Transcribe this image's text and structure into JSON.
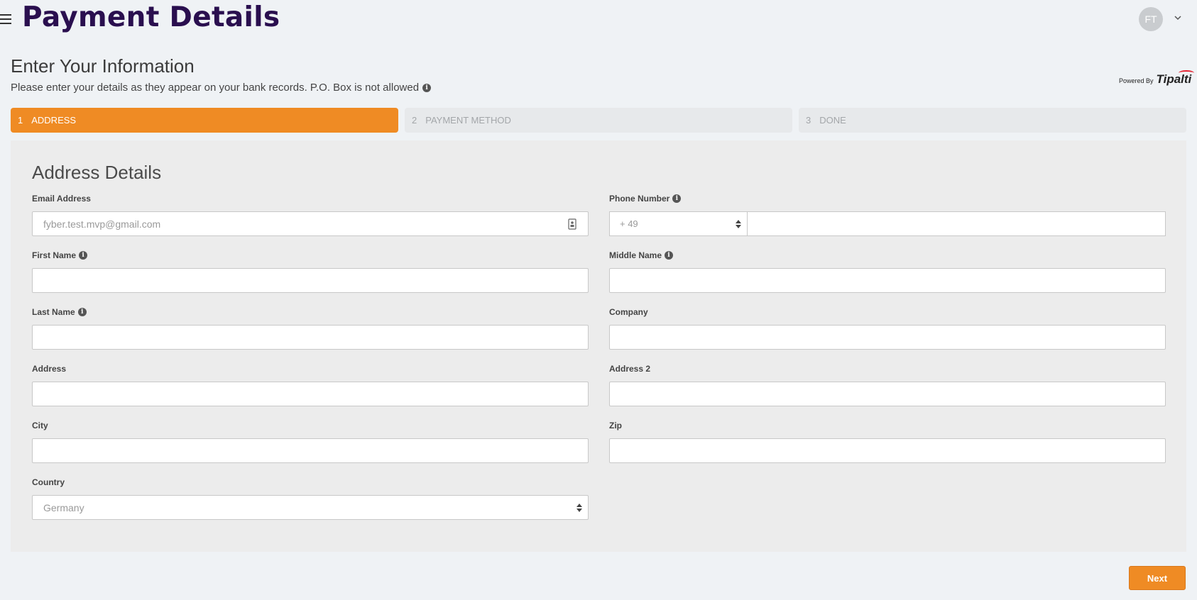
{
  "header": {
    "title": "Payment Details",
    "avatar_initials": "FT"
  },
  "intro": {
    "title": "Enter Your Information",
    "subtitle": "Please enter your details as they appear on your bank records. P.O. Box is not allowed"
  },
  "powered_by": {
    "label": "Powered By",
    "brand": "Tipalti"
  },
  "steps": [
    {
      "num": "1",
      "label": "ADDRESS",
      "active": true
    },
    {
      "num": "2",
      "label": "PAYMENT METHOD",
      "active": false
    },
    {
      "num": "3",
      "label": "DONE",
      "active": false
    }
  ],
  "form": {
    "title": "Address Details",
    "email": {
      "label": "Email Address",
      "value": "fyber.test.mvp@gmail.com"
    },
    "phone": {
      "label": "Phone Number",
      "code": "+ 49",
      "value": ""
    },
    "first_name": {
      "label": "First Name",
      "value": ""
    },
    "middle_name": {
      "label": "Middle Name",
      "value": ""
    },
    "last_name": {
      "label": "Last Name",
      "value": ""
    },
    "company": {
      "label": "Company",
      "value": ""
    },
    "address": {
      "label": "Address",
      "value": ""
    },
    "address2": {
      "label": "Address 2",
      "value": ""
    },
    "city": {
      "label": "City",
      "value": ""
    },
    "zip": {
      "label": "Zip",
      "value": ""
    },
    "country": {
      "label": "Country",
      "value": "Germany"
    }
  },
  "actions": {
    "next_label": "Next"
  },
  "colors": {
    "accent": "#ef8b24",
    "title": "#2a0f4f",
    "step_inactive": "#e7e9eb"
  }
}
